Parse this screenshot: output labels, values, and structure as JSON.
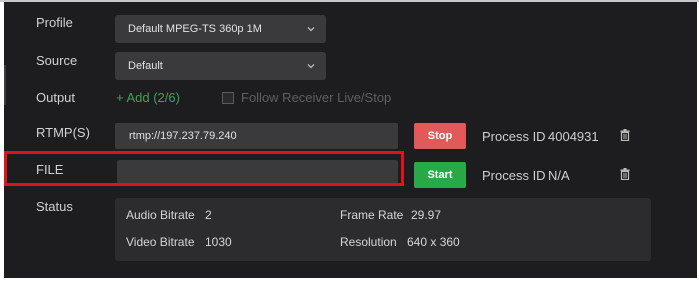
{
  "labels": {
    "profile": "Profile",
    "source": "Source",
    "output": "Output",
    "rtmp": "RTMP(S)",
    "file": "FILE",
    "status": "Status"
  },
  "profile": {
    "value": "Default MPEG-TS 360p 1M"
  },
  "source": {
    "value": "Default"
  },
  "output": {
    "add_label": "+ Add (2/6)",
    "follow_label": "Follow Receiver Live/Stop",
    "follow_checked": false
  },
  "rtmp": {
    "url": "rtmp://197.237.79.240",
    "button_label": "Stop",
    "process_label": "Process ID",
    "process_id": "4004931"
  },
  "file": {
    "value": "",
    "button_label": "Start",
    "process_label": "Process ID",
    "process_id": "N/A"
  },
  "status": {
    "audio_bitrate_label": "Audio Bitrate",
    "audio_bitrate": "2",
    "video_bitrate_label": "Video Bitrate",
    "video_bitrate": "1030",
    "frame_rate_label": "Frame Rate",
    "frame_rate": "29.97",
    "resolution_label": "Resolution",
    "resolution": "640 x 360"
  },
  "colors": {
    "background": "#1d1d1f",
    "field": "#3a3a3d",
    "stop": "#e05a5a",
    "start": "#26a947",
    "add_link": "#3aa555",
    "highlight": "#e0121a"
  }
}
